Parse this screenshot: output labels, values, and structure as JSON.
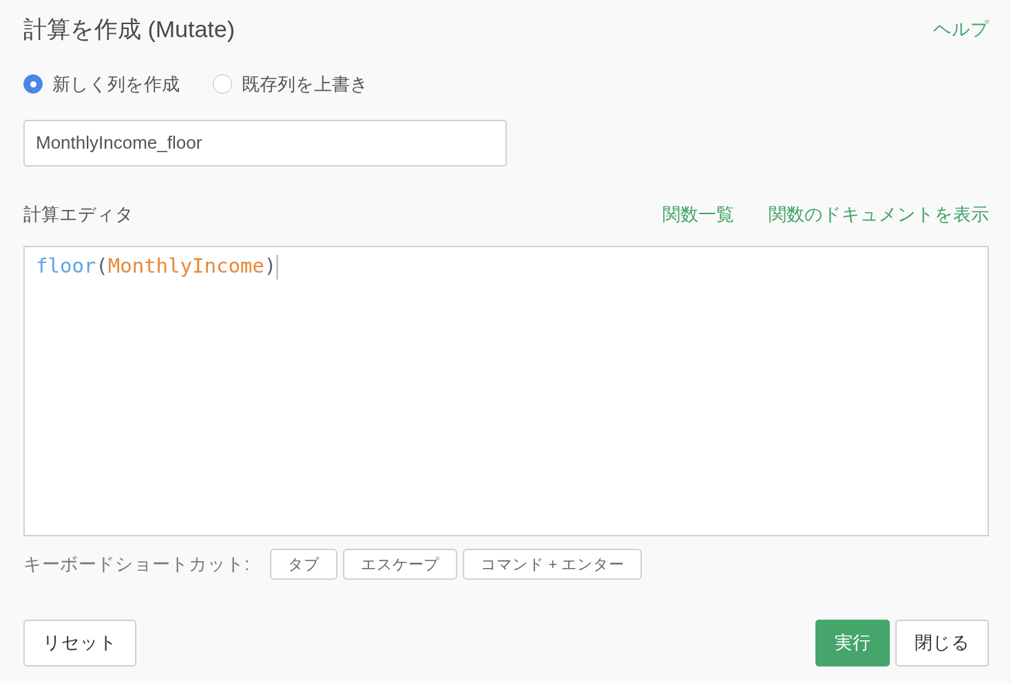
{
  "title": "計算を作成 (Mutate)",
  "help_link": "ヘルプ",
  "mode_options": [
    {
      "label": "新しく列を作成",
      "selected": true
    },
    {
      "label": "既存列を上書き",
      "selected": false
    }
  ],
  "column_name": {
    "value": "MonthlyIncome_floor"
  },
  "editor": {
    "label": "計算エディタ",
    "links": [
      "関数一覧",
      "関数のドキュメントを表示"
    ],
    "tokens": [
      {
        "kind": "function",
        "text": "floor"
      },
      {
        "kind": "paren",
        "text": "("
      },
      {
        "kind": "column",
        "text": "MonthlyIncome"
      },
      {
        "kind": "paren",
        "text": ")"
      }
    ]
  },
  "shortcuts": {
    "label": "キーボードショートカット:",
    "keys": [
      "タブ",
      "エスケープ",
      "コマンド + エンター"
    ]
  },
  "buttons": [
    {
      "kind": "secondary",
      "label": "リセット"
    },
    {
      "kind": "primary",
      "label": "実行"
    },
    {
      "kind": "secondary",
      "label": "閉じる"
    }
  ]
}
